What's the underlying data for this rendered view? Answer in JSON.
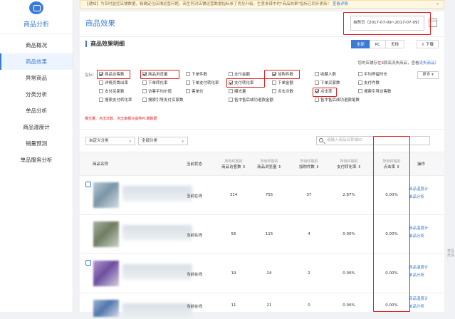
{
  "notice": {
    "text": "【通知】为实时监控店铺数据，精确定位店铺运营问题，商生阿对店铺运营数据指标参了优化升级，生意参谋中的\"商品效果\"指标已同步更新！",
    "link": "查看详情"
  },
  "sidebar": {
    "title": "商品分析",
    "items": [
      {
        "label": "商品概况",
        "active": false
      },
      {
        "label": "商品效果",
        "active": true
      },
      {
        "label": "异常商品",
        "active": false
      },
      {
        "label": "分类分析",
        "active": false
      },
      {
        "label": "单品分析",
        "active": false
      },
      {
        "label": "商品温度计",
        "active": false
      },
      {
        "label": "销量预测",
        "active": false
      },
      {
        "label": "单品服务分析",
        "active": false
      }
    ]
  },
  "header": {
    "title": "商品效果",
    "date_range": "自然日（2017-07-09~2017-07-09）"
  },
  "section": {
    "title": "商品效果明细",
    "segments": [
      "全部",
      "PC",
      "无线"
    ],
    "download": "下载",
    "hint_prefix": "您的店铺存在",
    "hint_count": "6",
    "hint_mid": "款高流失商品，查看",
    "hint_link": "流失商品）",
    "more": "更多",
    "filter_label": "指标："
  },
  "metrics": [
    {
      "label": "商品访客数",
      "checked": true
    },
    {
      "label": "商品浏览量",
      "checked": true
    },
    {
      "label": "下单件数",
      "checked": false
    },
    {
      "label": "支付金额",
      "checked": false
    },
    {
      "label": "加购件数",
      "checked": true
    },
    {
      "label": "收藏人数",
      "checked": false
    },
    {
      "label": "平均停留时长",
      "checked": false
    },
    {
      "label": "详情页跳出率",
      "checked": false
    },
    {
      "label": "下单转化率",
      "checked": false
    },
    {
      "label": "下单支付转化率",
      "checked": false
    },
    {
      "label": "支付转化率",
      "checked": true
    },
    {
      "label": "下单金额",
      "checked": false
    },
    {
      "label": "下单买家数",
      "checked": false
    },
    {
      "label": "支付件数",
      "checked": false
    },
    {
      "label": "支付买家数",
      "checked": false
    },
    {
      "label": "访客平均价值",
      "checked": false
    },
    {
      "label": "客单价",
      "checked": false
    },
    {
      "label": "曝光量",
      "checked": false
    },
    {
      "label": "点击次数",
      "checked": false
    },
    {
      "label": "点击率",
      "checked": true
    },
    {
      "label": "搜索引导访客数",
      "checked": false
    },
    {
      "label": "搜索支付转化率",
      "checked": false
    },
    {
      "label": "搜索引导支付买家数",
      "checked": false
    },
    {
      "label": "售中售后成功退款金额",
      "checked": false
    },
    {
      "label": "售中售后成功退款笔数",
      "checked": false
    }
  ],
  "metrics_note": "曝光量、点击次数、点击率都只提供PC端数据",
  "filters": {
    "category": "自定义分类",
    "all": "全部分类",
    "search_placeholder": "请输入商品名称或ID"
  },
  "table": {
    "headers": {
      "name": "商品名称",
      "status": "当前状态",
      "visitors": "商品访客数",
      "pv": "商品浏览量",
      "cart": "加购件数",
      "conversion": "支付转化率",
      "ctr": "点击率",
      "action": "操作"
    },
    "sub_header": "所有终端的",
    "rows": [
      {
        "status": "当前在线",
        "visitors": "314",
        "pv": "755",
        "cart": "37",
        "conversion": "2.87%",
        "ctr": "0.00%",
        "action1": "商品温度计",
        "action2": "单品分析"
      },
      {
        "status": "当前在线",
        "visitors": "56",
        "pv": "115",
        "cart": "4",
        "conversion": "0.00%",
        "ctr": "0.00%",
        "action1": "商品温度计",
        "action2": "单品分析"
      },
      {
        "status": "当前在线",
        "visitors": "19",
        "pv": "24",
        "cart": "2",
        "conversion": "0.00%",
        "ctr": "0.00%",
        "action1": "商品温度计",
        "action2": "单品分析"
      },
      {
        "status": "当前在线",
        "visitors": "11",
        "pv": "21",
        "cart": "0",
        "conversion": "0.00%",
        "ctr": "0.00%",
        "action1": "商品温度计",
        "action2": "单品分析"
      }
    ]
  },
  "side_widget": "意见反馈",
  "colors": {
    "accent": "#3a7bd5",
    "highlight": "#e02020"
  }
}
